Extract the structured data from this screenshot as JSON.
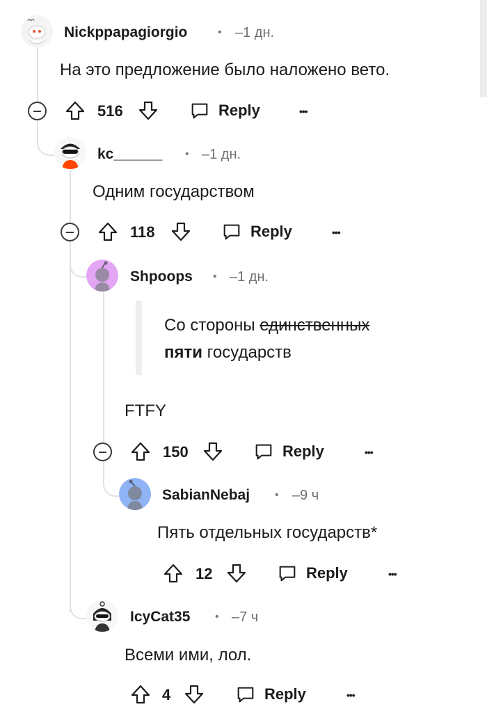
{
  "comments": [
    {
      "author": "Nickppapagiorgio",
      "time": "–1 дн.",
      "text": "На это предложение было наложено вето.",
      "score": "516",
      "reply": "Reply",
      "more": "•••"
    },
    {
      "author": "kc______",
      "time": "–1 дн.",
      "text": "Одним государством",
      "score": "118",
      "reply": "Reply",
      "more": "•••"
    },
    {
      "author": "Shpoops",
      "time": "–1 дн.",
      "quote_line1_prefix": "Со стороны ",
      "quote_line1_struck": "единственных",
      "quote_line2_bold": "пяти",
      "quote_line2_rest": " государств",
      "text": "FTFY",
      "score": "150",
      "reply": "Reply",
      "more": "•••"
    },
    {
      "author": "SabianNebaj",
      "time": "–9 ч",
      "text": "Пять отдельных государств*",
      "score": "12",
      "reply": "Reply",
      "more": "•••"
    },
    {
      "author": "IcyCat35",
      "time": "–7 ч",
      "text": "Всеми ими, лол.",
      "score": "4",
      "reply": "Reply",
      "more": "•••"
    }
  ],
  "separator": "•",
  "icons": {
    "upvote": "arrow-up-icon",
    "downvote": "arrow-down-icon",
    "reply": "speech-bubble-icon",
    "collapse": "minus-circle-icon"
  },
  "colors": {
    "avatar_shpoops": "#e3a6f5",
    "avatar_sabian": "#8fb3f5",
    "thread_line": "#e2e2e2"
  }
}
